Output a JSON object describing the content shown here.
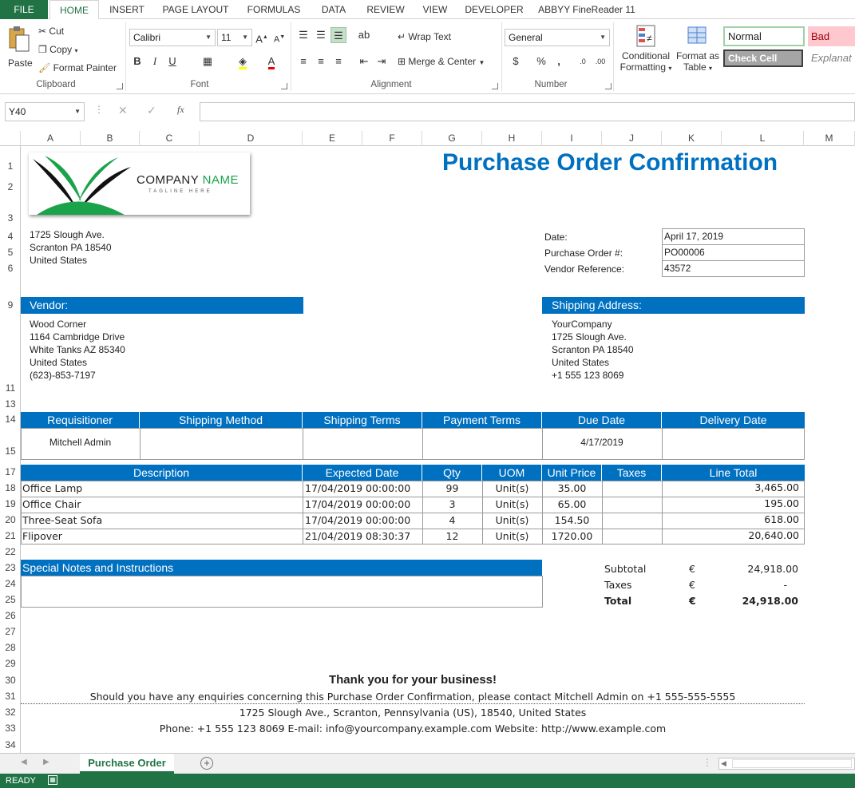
{
  "ribbon_tabs": [
    "FILE",
    "HOME",
    "INSERT",
    "PAGE LAYOUT",
    "FORMULAS",
    "DATA",
    "REVIEW",
    "VIEW",
    "DEVELOPER",
    "ABBYY FineReader 11"
  ],
  "clipboard": {
    "paste": "Paste",
    "cut": "Cut",
    "copy": "Copy",
    "format_painter": "Format Painter",
    "label": "Clipboard"
  },
  "font": {
    "name": "Calibri",
    "size": "11",
    "label": "Font",
    "bold": "B",
    "italic": "I",
    "underline": "U"
  },
  "alignment": {
    "wrap_text": "Wrap Text",
    "merge_center": "Merge & Center",
    "label": "Alignment"
  },
  "number": {
    "format": "General",
    "currency": "$",
    "percent": "%",
    "comma": ",",
    "label": "Number"
  },
  "styles": {
    "conditional": "Conditional",
    "conditional2": "Formatting",
    "format_as": "Format as",
    "format_as2": "Table",
    "normal": "Normal",
    "bad": "Bad",
    "check_cell": "Check Cell",
    "explanatory": "Explanat"
  },
  "formula_bar": {
    "name_box": "Y40",
    "fx": "fx",
    "value": ""
  },
  "columns": [
    "A",
    "B",
    "C",
    "D",
    "E",
    "F",
    "G",
    "H",
    "I",
    "J",
    "K",
    "L",
    "M"
  ],
  "rows": [
    "1",
    "2",
    "3",
    "4",
    "5",
    "6",
    "9",
    "11",
    "13",
    "14",
    "15",
    "17",
    "18",
    "19",
    "20",
    "21",
    "22",
    "23",
    "24",
    "25",
    "26",
    "27",
    "28",
    "29",
    "30",
    "31",
    "32",
    "33",
    "34"
  ],
  "doc": {
    "logo_company": "COMPANY",
    "logo_name": "NAME",
    "logo_tagline": "TAGLINE HERE",
    "title": "Purchase Order Confirmation",
    "company_address": [
      "1725 Slough Ave.",
      "Scranton PA 18540",
      "United States"
    ],
    "meta_labels": [
      "Date:",
      "Purchase Order #:",
      "Vendor Reference:"
    ],
    "meta_values": [
      "April 17, 2019",
      "PO00006",
      "43572"
    ],
    "vendor_label": "Vendor:",
    "vendor_lines": [
      "Wood Corner",
      "1164 Cambridge Drive",
      "White Tanks AZ 85340",
      "United States",
      "(623)-853-7197"
    ],
    "shipping_label": "Shipping Address:",
    "shipping_lines": [
      "YourCompany",
      "1725 Slough Ave.",
      "Scranton PA 18540",
      "United States",
      "+1 555 123 8069"
    ],
    "info_headers": [
      "Requisitioner",
      "Shipping Method",
      "Shipping Terms",
      "Payment Terms",
      "Due Date",
      "Delivery Date"
    ],
    "info_values": [
      "Mitchell Admin",
      "",
      "",
      "",
      "4/17/2019",
      ""
    ],
    "line_headers": [
      "Description",
      "Expected Date",
      "Qty",
      "UOM",
      "Unit Price",
      "Taxes",
      "Line Total"
    ],
    "lines": [
      {
        "desc": "Office Lamp",
        "date": "17/04/2019 00:00:00",
        "qty": "99",
        "uom": "Unit(s)",
        "price": "35.00",
        "taxes": "",
        "total": "3,465.00"
      },
      {
        "desc": "Office Chair",
        "date": "17/04/2019 00:00:00",
        "qty": "3",
        "uom": "Unit(s)",
        "price": "65.00",
        "taxes": "",
        "total": "195.00"
      },
      {
        "desc": "Three-Seat Sofa",
        "date": "17/04/2019 00:00:00",
        "qty": "4",
        "uom": "Unit(s)",
        "price": "154.50",
        "taxes": "",
        "total": "618.00"
      },
      {
        "desc": "Flipover",
        "date": "21/04/2019 08:30:37",
        "qty": "12",
        "uom": "Unit(s)",
        "price": "1720.00",
        "taxes": "",
        "total": "20,640.00"
      }
    ],
    "notes_label": "Special Notes and Instructions",
    "totals": [
      {
        "label": "Subtotal",
        "cur": "€",
        "value": "24,918.00"
      },
      {
        "label": "Taxes",
        "cur": "€",
        "value": "-"
      },
      {
        "label": "Total",
        "cur": "€",
        "value": "24,918.00"
      }
    ],
    "thanks": "Thank you for your business!",
    "enquiries": "Should you have any enquiries concerning this Purchase Order Confirmation, please contact Mitchell Admin on +1 555-555-5555",
    "footer_address": "1725 Slough Ave., Scranton, Pennsylvania (US), 18540, United States",
    "footer_contact": "Phone: +1 555 123 8069  E-mail: info@yourcompany.example.com  Website: http://www.example.com"
  },
  "sheet_tab": "Purchase Order",
  "status": "READY",
  "colors": {
    "excel_green": "#217346",
    "po_blue": "#0070c0",
    "title_blue": "#0070c0",
    "logo_green": "#1aa34a"
  }
}
